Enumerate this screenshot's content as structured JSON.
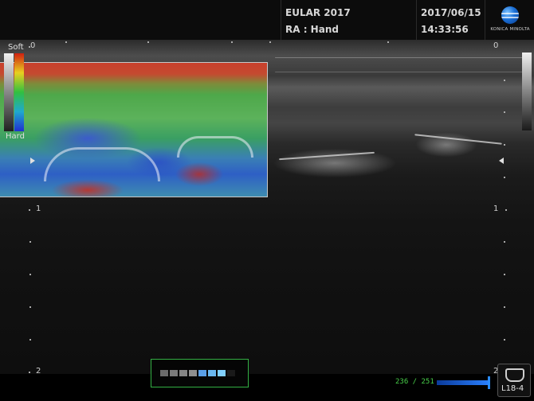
{
  "header": {
    "study": "EULAR 2017",
    "exam": "RA : Hand",
    "date": "2017/06/15",
    "time": "14:33:56",
    "logo_text": "KONICA MINOLTA"
  },
  "elastography": {
    "soft_label": "Soft",
    "hard_label": "Hard",
    "colors": {
      "soft": "#d02010",
      "mid": "#30c040",
      "hard": "#2030d0"
    }
  },
  "depth_scale": {
    "left": [
      "0",
      "1",
      "2"
    ],
    "right": [
      "0",
      "1",
      "2"
    ]
  },
  "status": {
    "frame_counter": "236 / 251",
    "probe": "L18-4"
  },
  "focus_indicator": {
    "segments": 7,
    "active_segments": [
      4,
      5,
      6
    ]
  }
}
